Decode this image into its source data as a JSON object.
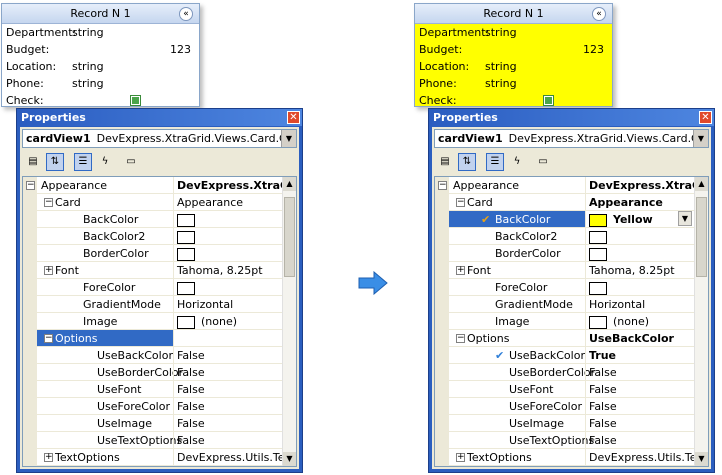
{
  "left": {
    "card": {
      "title": "Record N 1",
      "collapse_glyph": "«",
      "background": "#ffffff",
      "rows": [
        {
          "key": "Department:",
          "value": "string"
        },
        {
          "key": "Budget:",
          "value": "123"
        },
        {
          "key": "Location:",
          "value": "string"
        },
        {
          "key": "Phone:",
          "value": "string"
        },
        {
          "key": "Check:",
          "value": ""
        }
      ]
    },
    "props": {
      "title": "Properties",
      "close": "✕",
      "object_name": "cardView1",
      "object_type": "DevExpress.XtraGrid.Views.Card.Card",
      "combo_arrow": "▼",
      "rows": [
        {
          "name": "Appearance",
          "value": "DevExpress.XtraGrid",
          "expander": "−",
          "level": 0,
          "bold_value": true
        },
        {
          "name": "Card",
          "value": "Appearance",
          "expander": "−",
          "level": 1
        },
        {
          "name": "BackColor",
          "value": "",
          "swatch": "#ffffff",
          "level": 2
        },
        {
          "name": "BackColor2",
          "value": "",
          "swatch": "#ffffff",
          "level": 2
        },
        {
          "name": "BorderColor",
          "value": "",
          "swatch": "#ffffff",
          "level": 2
        },
        {
          "name": "Font",
          "value": "Tahoma, 8.25pt",
          "expander": "+",
          "level": 1
        },
        {
          "name": "ForeColor",
          "value": "",
          "swatch": "#ffffff",
          "level": 2
        },
        {
          "name": "GradientMode",
          "value": "Horizontal",
          "level": 2
        },
        {
          "name": "Image",
          "value": "(none)",
          "swatch": "#ffffff",
          "level": 2
        },
        {
          "name": "Options",
          "value": "",
          "expander": "−",
          "level": 1,
          "selected": true
        },
        {
          "name": "UseBackColor",
          "value": "False",
          "level": 3
        },
        {
          "name": "UseBorderColor",
          "value": "False",
          "level": 3
        },
        {
          "name": "UseFont",
          "value": "False",
          "level": 3
        },
        {
          "name": "UseForeColor",
          "value": "False",
          "level": 3
        },
        {
          "name": "UseImage",
          "value": "False",
          "level": 3
        },
        {
          "name": "UseTextOptions",
          "value": "False",
          "level": 3
        },
        {
          "name": "TextOptions",
          "value": "DevExpress.Utils.TextOp",
          "expander": "+",
          "level": 1
        }
      ]
    }
  },
  "right": {
    "card": {
      "title": "Record N 1",
      "collapse_glyph": "«",
      "background": "#ffff00",
      "rows": [
        {
          "key": "Department:",
          "value": "string"
        },
        {
          "key": "Budget:",
          "value": "123"
        },
        {
          "key": "Location:",
          "value": "string"
        },
        {
          "key": "Phone:",
          "value": "string"
        },
        {
          "key": "Check:",
          "value": ""
        }
      ]
    },
    "props": {
      "title": "Properties",
      "close": "✕",
      "object_name": "cardView1",
      "object_type": "DevExpress.XtraGrid.Views.Card.Card",
      "combo_arrow": "▼",
      "rows": [
        {
          "name": "Appearance",
          "value": "DevExpress.XtraGrid",
          "expander": "−",
          "level": 0,
          "bold_value": true
        },
        {
          "name": "Card",
          "value": "Appearance",
          "expander": "−",
          "level": 1,
          "bold_value": true
        },
        {
          "name": "BackColor",
          "value": "Yellow",
          "swatch": "#ffff00",
          "level": 2,
          "selected": true,
          "bold_value": true,
          "marker": "✔",
          "marker_color": "#e8a317",
          "dropdown": "▼"
        },
        {
          "name": "BackColor2",
          "value": "",
          "swatch": "#ffffff",
          "level": 2
        },
        {
          "name": "BorderColor",
          "value": "",
          "swatch": "#ffffff",
          "level": 2
        },
        {
          "name": "Font",
          "value": "Tahoma, 8.25pt",
          "expander": "+",
          "level": 1
        },
        {
          "name": "ForeColor",
          "value": "",
          "swatch": "#ffffff",
          "level": 2
        },
        {
          "name": "GradientMode",
          "value": "Horizontal",
          "level": 2
        },
        {
          "name": "Image",
          "value": "(none)",
          "swatch": "#ffffff",
          "level": 2
        },
        {
          "name": "Options",
          "value": "UseBackColor",
          "expander": "−",
          "level": 1,
          "bold_value": true
        },
        {
          "name": "UseBackColor",
          "value": "True",
          "level": 3,
          "bold_value": true,
          "marker": "✔",
          "marker_color": "#2f7fd8"
        },
        {
          "name": "UseBorderColor",
          "value": "False",
          "level": 3
        },
        {
          "name": "UseFont",
          "value": "False",
          "level": 3
        },
        {
          "name": "UseForeColor",
          "value": "False",
          "level": 3
        },
        {
          "name": "UseImage",
          "value": "False",
          "level": 3
        },
        {
          "name": "UseTextOptions",
          "value": "False",
          "level": 3
        },
        {
          "name": "TextOptions",
          "value": "DevExpress.Utils.TextOp",
          "expander": "+",
          "level": 1
        }
      ]
    }
  },
  "arrow_color": "#3a8ee6"
}
